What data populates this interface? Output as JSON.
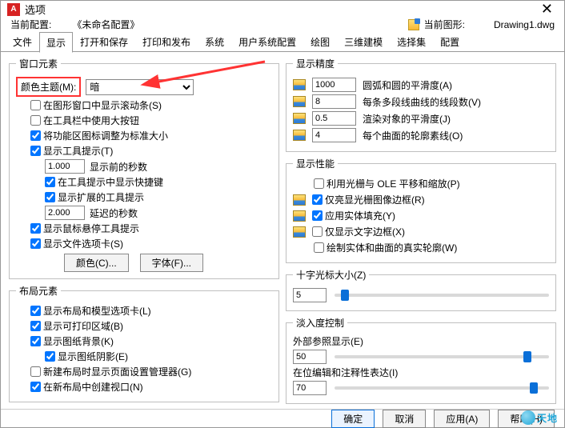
{
  "window": {
    "title": "选项"
  },
  "profile": {
    "current_profile_label": "当前配置:",
    "current_profile_value": "《未命名配置》",
    "current_drawing_label": "当前图形:",
    "current_drawing_value": "Drawing1.dwg"
  },
  "tabs": {
    "items": [
      "文件",
      "显示",
      "打开和保存",
      "打印和发布",
      "系统",
      "用户系统配置",
      "绘图",
      "三维建模",
      "选择集",
      "配置"
    ],
    "active_index": 1
  },
  "window_elements": {
    "legend": "窗口元素",
    "color_theme_label": "颜色主题(M):",
    "color_theme_value": "暗",
    "scrollbars": "在图形窗口中显示滚动条(S)",
    "big_buttons": "在工具栏中使用大按钮",
    "resize_ribbon": "将功能区图标调整为标准大小",
    "show_tooltip": "显示工具提示(T)",
    "tooltip_seconds_val": "1.000",
    "tooltip_seconds_label": "显示前的秒数",
    "shortcut_in_tooltip": "在工具提示中显示快捷键",
    "extended_tooltip": "显示扩展的工具提示",
    "delay_seconds_val": "2.000",
    "delay_seconds_label": "延迟的秒数",
    "hover_tooltip": "显示鼠标悬停工具提示",
    "show_file_tab": "显示文件选项卡(S)",
    "color_btn": "颜色(C)...",
    "font_btn": "字体(F)..."
  },
  "layout_elements": {
    "legend": "布局元素",
    "show_layout_tabs": "显示布局和模型选项卡(L)",
    "printable_area": "显示可打印区域(B)",
    "paper_bg": "显示图纸背景(K)",
    "paper_shadow": "显示图纸阴影(E)",
    "page_setup_mgr": "新建布局时显示页面设置管理器(G)",
    "create_viewport": "在新布局中创建视口(N)"
  },
  "display_precision": {
    "legend": "显示精度",
    "arc_val": "1000",
    "arc_label": "圆弧和圆的平滑度(A)",
    "seg_val": "8",
    "seg_label": "每条多段线曲线的线段数(V)",
    "render_val": "0.5",
    "render_label": "渲染对象的平滑度(J)",
    "contour_val": "4",
    "contour_label": "每个曲面的轮廓素线(O)"
  },
  "display_perf": {
    "legend": "显示性能",
    "raster_ole": "利用光栅与 OLE 平移和缩放(P)",
    "highlight_raster": "仅亮显光栅图像边框(R)",
    "solid_fill": "应用实体填充(Y)",
    "text_frame": "仅显示文字边框(X)",
    "true_silh": "绘制实体和曲面的真实轮廓(W)"
  },
  "crosshair": {
    "legend": "十字光标大小(Z)",
    "value": "5"
  },
  "fade": {
    "legend": "淡入度控制",
    "xref_label": "外部参照显示(E)",
    "xref_value": "50",
    "inplace_label": "在位编辑和注释性表达(I)",
    "inplace_value": "70"
  },
  "footer": {
    "ok": "确定",
    "cancel": "取消",
    "apply": "应用(A)",
    "help": "帮助(H)"
  },
  "checks": {
    "scrollbars": false,
    "big_buttons": false,
    "resize_ribbon": true,
    "show_tooltip": true,
    "shortcut_in_tooltip": true,
    "extended_tooltip": true,
    "hover_tooltip": true,
    "show_file_tab": true,
    "show_layout_tabs": true,
    "printable_area": true,
    "paper_bg": true,
    "paper_shadow": true,
    "page_setup_mgr": false,
    "create_viewport": true,
    "raster_ole": false,
    "highlight_raster": true,
    "solid_fill": true,
    "text_frame": false,
    "true_silh": false
  }
}
